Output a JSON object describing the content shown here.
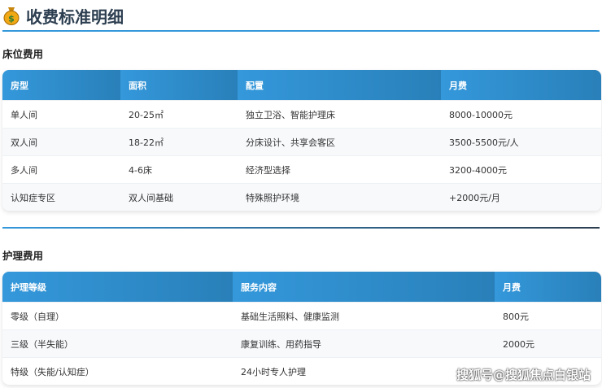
{
  "title": "收费标准明细",
  "bed": {
    "section": "床位费用",
    "headers": [
      "房型",
      "面积",
      "配置",
      "月费"
    ],
    "rows": [
      [
        "单人间",
        "20-25㎡",
        "独立卫浴、智能护理床",
        "8000-10000元"
      ],
      [
        "双人间",
        "18-22㎡",
        "分床设计、共享会客区",
        "3500-5500元/人"
      ],
      [
        "多人间",
        "4-6床",
        "经济型选择",
        "3200-4000元"
      ],
      [
        "认知症专区",
        "双人间基础",
        "特殊照护环境",
        "+2000元/月"
      ]
    ]
  },
  "care": {
    "section": "护理费用",
    "headers": [
      "护理等级",
      "服务内容",
      "月费"
    ],
    "rows": [
      [
        "零级（自理）",
        "基础生活照料、健康监测",
        "800元"
      ],
      [
        "三级（半失能）",
        "康复训练、用药指导",
        "2000元"
      ],
      [
        "特级（失能/认知症）",
        "24小时专人护理",
        ""
      ]
    ]
  },
  "watermark": "搜狐号@搜狐焦点白银站"
}
